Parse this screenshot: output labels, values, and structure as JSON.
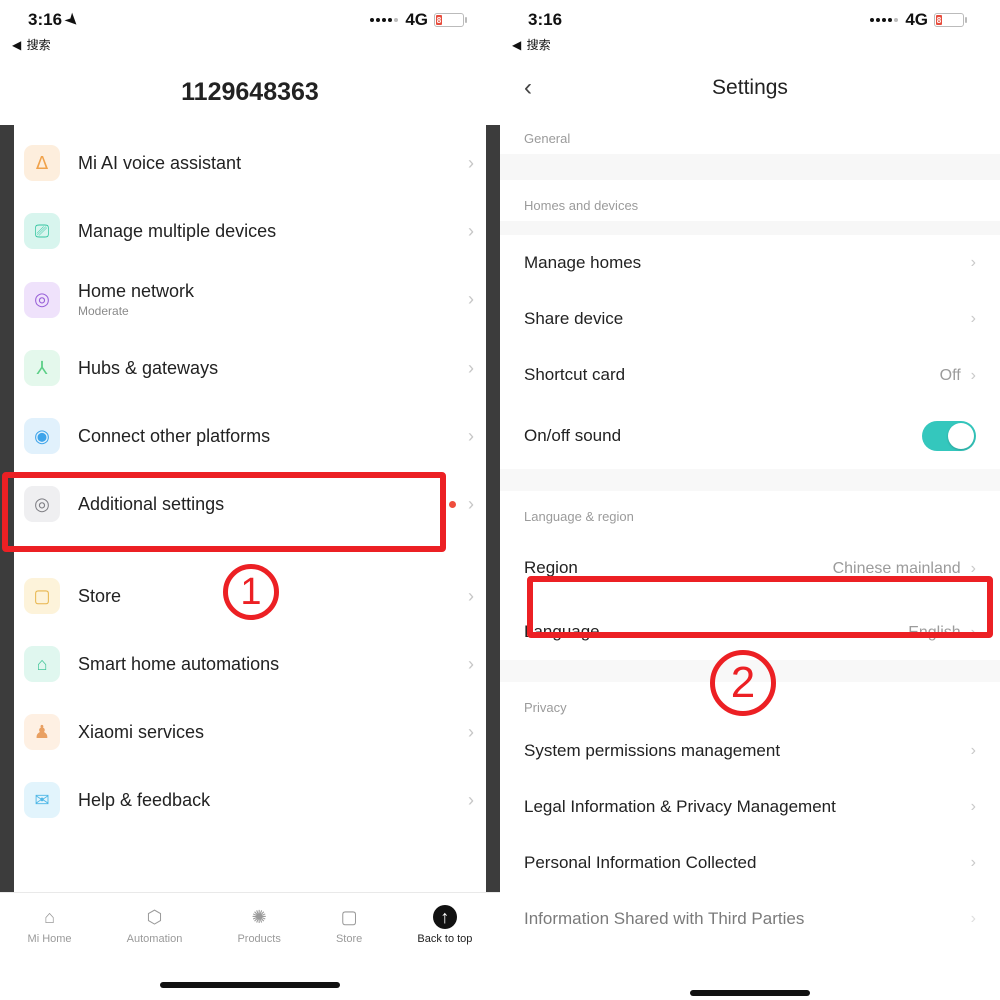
{
  "status": {
    "time": "3:16",
    "back_label": "搜索",
    "network": "4G",
    "battery_text": "8"
  },
  "left": {
    "title": "1129648363",
    "items": {
      "ai": {
        "label": "Mi AI voice assistant"
      },
      "devices": {
        "label": "Manage multiple devices"
      },
      "network": {
        "label": "Home network",
        "sub": "Moderate"
      },
      "hubs": {
        "label": "Hubs & gateways"
      },
      "platforms": {
        "label": "Connect other platforms"
      },
      "settings": {
        "label": "Additional settings"
      },
      "store": {
        "label": "Store"
      },
      "auto": {
        "label": "Smart home automations"
      },
      "services": {
        "label": "Xiaomi services"
      },
      "help": {
        "label": "Help & feedback"
      }
    },
    "tabs": {
      "home": "Mi Home",
      "auto": "Automation",
      "prod": "Products",
      "store": "Store",
      "top": "Back to top"
    }
  },
  "right": {
    "title": "Settings",
    "sections": {
      "general": "General",
      "homes": "Homes and devices",
      "lang": "Language & region",
      "privacy": "Privacy"
    },
    "rows": {
      "manage_homes": "Manage homes",
      "share_device": "Share device",
      "shortcut": "Shortcut card",
      "shortcut_val": "Off",
      "sound": "On/off sound",
      "region": "Region",
      "region_val": "Chinese mainland",
      "language": "Language",
      "language_val": "English",
      "sys_perm": "System permissions management",
      "legal": "Legal Information & Privacy Management",
      "personal": "Personal Information Collected",
      "shared3p": "Information Shared with Third Parties"
    }
  },
  "annotations": {
    "one": "1",
    "two": "2"
  }
}
